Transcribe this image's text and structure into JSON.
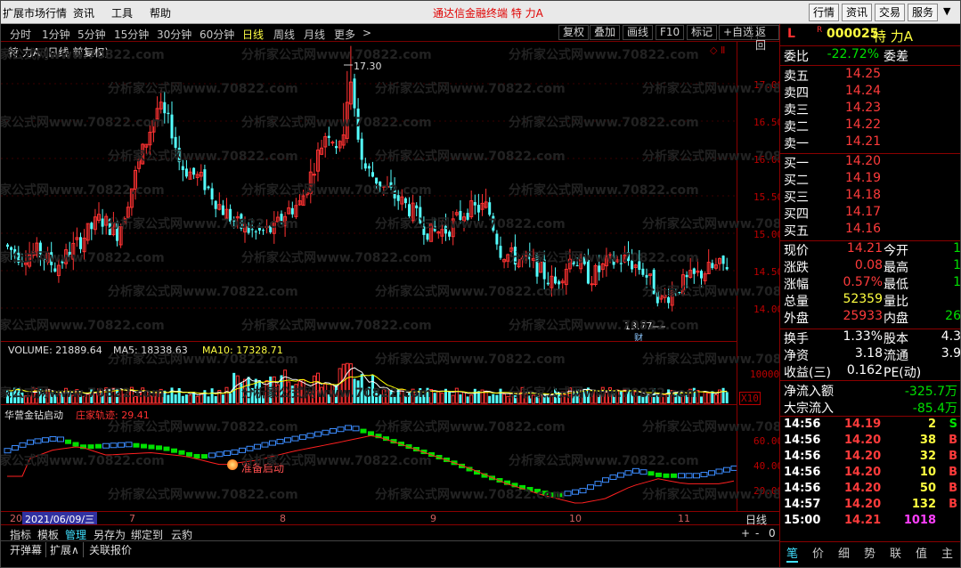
{
  "menubar": {
    "items": [
      "扩展市场行情",
      "资讯",
      "工具",
      "帮助"
    ],
    "center_title": "通达信金融终端   特 力A",
    "right_buttons": [
      "行情",
      "资讯",
      "交易",
      "服务"
    ]
  },
  "toolbar": {
    "periods": [
      "分时",
      "1分钟",
      "5分钟",
      "15分钟",
      "30分钟",
      "60分钟",
      "日线",
      "周线",
      "月线",
      "更多"
    ],
    "more_arrow": ">",
    "active_period": "日线",
    "right_buttons": [
      "复权",
      "叠加",
      "画线",
      "F10",
      "标记",
      "+自选",
      "返回"
    ]
  },
  "price_panel": {
    "title": "特 力A (日线 前复权)",
    "high_label": "17.30",
    "low_label": "13.77",
    "cai_marker": "财",
    "corner_icons": "◇ Ⅱ"
  },
  "volume_panel": {
    "label": "VOLUME: 21889.64",
    "ma5": "MA5: 18338.63",
    "ma10": "MA10: 17328.71",
    "axis_label": "10000",
    "unit": "X10",
    "dollar_marker": "$"
  },
  "indicator_panel": {
    "name": "华营金钻启动",
    "sub": "庄家轨迹: 29.41",
    "signal": "准备启动",
    "axis": [
      "60.00",
      "40.00",
      "20.00"
    ]
  },
  "price_axis": [
    "17.00",
    "16.50",
    "16.00",
    "15.50",
    "15.00",
    "14.50",
    "14.00"
  ],
  "datebar": {
    "prefix": "20",
    "cursor_date": "2021/06/09/三",
    "months": [
      "7",
      "8",
      "9",
      "10",
      "11"
    ],
    "period": "日线",
    "controls": [
      "+",
      "-",
      "0"
    ]
  },
  "bottom_tabs1": [
    "指标",
    "模板",
    "管理",
    "另存为",
    "绑定到",
    "云豹"
  ],
  "bottom_tabs2": [
    "开弹幕",
    "扩展∧",
    "关联报价"
  ],
  "watermark": "分析家公式网www.70822.com",
  "quote": {
    "flag": "L",
    "r": "R",
    "code": "000025",
    "name": "特 力A",
    "weibi_label": "委比",
    "weibi": "-22.72%",
    "weicha_label": "委差",
    "sells": [
      {
        "label": "卖五",
        "price": "14.25"
      },
      {
        "label": "卖四",
        "price": "14.24"
      },
      {
        "label": "卖三",
        "price": "14.23"
      },
      {
        "label": "卖二",
        "price": "14.22"
      },
      {
        "label": "卖一",
        "price": "14.21"
      }
    ],
    "buys": [
      {
        "label": "买一",
        "price": "14.20"
      },
      {
        "label": "买二",
        "price": "14.19"
      },
      {
        "label": "买三",
        "price": "14.18"
      },
      {
        "label": "买四",
        "price": "14.17"
      },
      {
        "label": "买五",
        "price": "14.16"
      }
    ],
    "stats": [
      {
        "l1": "现价",
        "v1": "14.21",
        "c1": "red",
        "l2": "今开",
        "v2": "1",
        "c2": "grn"
      },
      {
        "l1": "涨跌",
        "v1": "0.08",
        "c1": "red",
        "l2": "最高",
        "v2": "1",
        "c2": "grn"
      },
      {
        "l1": "涨幅",
        "v1": "0.57%",
        "c1": "red",
        "l2": "最低",
        "v2": "1",
        "c2": "grn"
      },
      {
        "l1": "总量",
        "v1": "52359",
        "c1": "yel",
        "l2": "量比",
        "v2": "",
        "c2": "grn"
      },
      {
        "l1": "外盘",
        "v1": "25933",
        "c1": "red",
        "l2": "内盘",
        "v2": "26",
        "c2": "grn"
      }
    ],
    "stats2": [
      {
        "l1": "换手",
        "v1": "1.33%",
        "l2": "股本",
        "v2": "4.3"
      },
      {
        "l1": "净资",
        "v1": "3.18",
        "l2": "流通",
        "v2": "3.9"
      },
      {
        "l1": "收益(三)",
        "v1": "0.162",
        "l2": "PE(动)",
        "v2": ""
      }
    ],
    "flow": [
      {
        "label": "净流入额",
        "value": "-325.7万"
      },
      {
        "label": "大宗流入",
        "value": "-85.4万"
      }
    ],
    "ticks": [
      {
        "time": "14:56",
        "price": "14.19",
        "vol": "2",
        "bs": "S",
        "bsc": "grn"
      },
      {
        "time": "14:56",
        "price": "14.20",
        "vol": "38",
        "bs": "B",
        "bsc": "red"
      },
      {
        "time": "14:56",
        "price": "14.20",
        "vol": "32",
        "bs": "B",
        "bsc": "red"
      },
      {
        "time": "14:56",
        "price": "14.20",
        "vol": "10",
        "bs": "B",
        "bsc": "red"
      },
      {
        "time": "14:56",
        "price": "14.20",
        "vol": "50",
        "bs": "B",
        "bsc": "red"
      },
      {
        "time": "14:57",
        "price": "14.20",
        "vol": "132",
        "bs": "B",
        "bsc": "red"
      },
      {
        "time": "15:00",
        "price": "14.21",
        "vol": "1018",
        "bs": "",
        "bsc": "red"
      }
    ],
    "tabs": [
      "笔",
      "价",
      "细",
      "势",
      "联",
      "值",
      "主"
    ]
  },
  "colors": {
    "up": "#ff3232",
    "down": "#54ffff",
    "ma5": "#ffffff",
    "ma10": "#ffff00",
    "axis": "#8b0000"
  }
}
